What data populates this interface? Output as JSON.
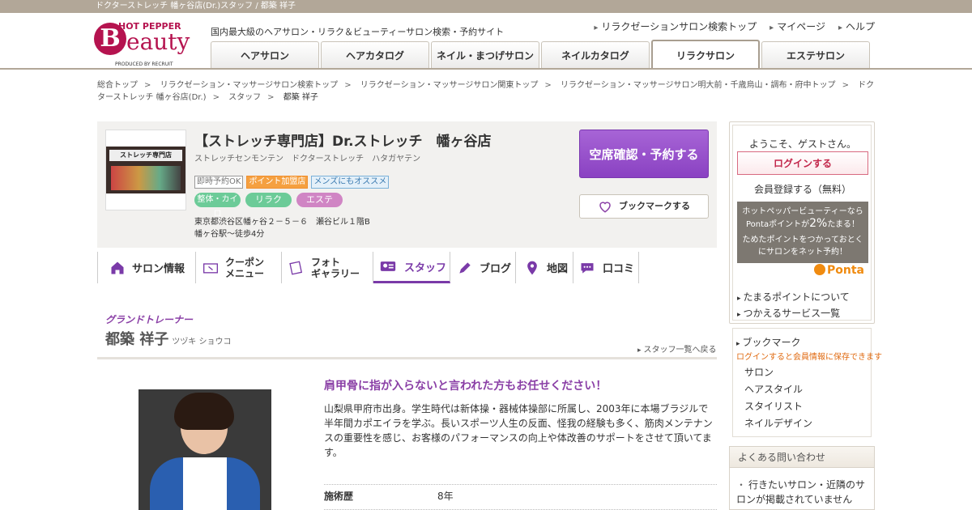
{
  "topbar": {
    "text": "ドクターストレッチ 幡ヶ谷店(Dr.)スタッフ / 都築 祥子"
  },
  "header": {
    "logo_hotpepper": "HOT PEPPER",
    "logo_b": "B",
    "logo_rest": "eauty",
    "logo_produced": "PRODUCED BY RECRUIT",
    "tagline": "国内最大級のヘアサロン・リラク＆ビューティーサロン検索・予約サイト",
    "links": [
      "リラクゼーションサロン検索トップ",
      "マイページ",
      "ヘルプ"
    ],
    "tabs": [
      "ヘアサロン",
      "ヘアカタログ",
      "ネイル・まつげサロン",
      "ネイルカタログ",
      "リラクサロン",
      "エステサロン"
    ],
    "active_tab_index": 4
  },
  "breadcrumbs": [
    "総合トップ",
    "リラクゼーション・マッサージサロン検索トップ",
    "リラクゼーション・マッサージサロン関東トップ",
    "リラクゼーション・マッサージサロン明大前・千歳烏山・調布・府中トップ",
    "ドクターストレッチ 幡ヶ谷店(Dr.)",
    "スタッフ",
    "都築 祥子"
  ],
  "salon": {
    "image_sign": "ストレッチ専門店",
    "title": "【ストレッチ専門店】Dr.ストレッチ　幡ヶ谷店",
    "kana": "ストレッチセンモンテン　ドクターストレッチ　ハタガヤテン",
    "badges": [
      "即時予約OK",
      "ポイント加盟店",
      "メンズにもオススメ"
    ],
    "genres": [
      "整体・カイロ",
      "リラク",
      "エステ"
    ],
    "address": "東京都渋谷区幡ヶ谷２－５－６　瀬谷ビル１階B",
    "access": "幡ヶ谷駅～徒歩4分",
    "reserve_label": "空席確認・予約する",
    "bookmark_label": "ブックマークする"
  },
  "salon_tabs": [
    {
      "label": "サロン情報",
      "icon": "home-icon"
    },
    {
      "label": "クーポン\nメニュー",
      "icon": "coupon-icon"
    },
    {
      "label": "フォト\nギャラリー",
      "icon": "photo-icon"
    },
    {
      "label": "スタッフ",
      "icon": "staff-card-icon",
      "active": true
    },
    {
      "label": "ブログ",
      "icon": "pencil-icon"
    },
    {
      "label": "地図",
      "icon": "map-pin-icon"
    },
    {
      "label": "口コミ",
      "icon": "speech-bubble-icon"
    }
  ],
  "staff": {
    "position": "グランドトレーナー",
    "name": "都築 祥子",
    "kana": "ツヅキ ショウコ",
    "back_link": "スタッフ一覧へ戻る",
    "catch": "肩甲骨に指が入らないと言われた方もお任せください！",
    "description": "山梨県甲府市出身。学生時代は新体操・器械体操部に所属し、2003年に本場ブラジルで半年間カポエイラを学ぶ。長いスポーツ人生の反面、怪我の経験も多く、筋肉メンテナンスの重要性を感じ、お客様のパフォーマンスの向上や体改善のサポートをさせて頂いてます。",
    "experience_label": "施術歴",
    "experience_value": "8年"
  },
  "sidebar": {
    "greeting": "ようこそ、ゲストさん。",
    "login": "ログインする",
    "register": "会員登録する（無料）",
    "ponta_line1": "ホットペッパービューティーなら",
    "ponta_line2_pre": "Pontaポイントが",
    "ponta_pct": "2%",
    "ponta_line2_post": "たまる！",
    "ponta_line3": "ためたポイントをつかっておとく",
    "ponta_line4": "にサロンをネット予約！",
    "ponta_logo": "Ponta",
    "links": [
      "たまるポイントについて",
      "つかえるサービス一覧"
    ],
    "bookmark_title": "ブックマーク",
    "bookmark_note": "ログインすると会員情報に保存できます",
    "bookmark_items": [
      "サロン",
      "ヘアスタイル",
      "スタイリスト",
      "ネイルデザイン"
    ],
    "faq_title": "よくある問い合わせ",
    "faq_first": "行きたいサロン・近隣のサロンが掲載されていません"
  },
  "colors": {
    "brand": "#b5134f",
    "accent_purple": "#8a3fa6",
    "reserve": "#9a52cc",
    "header_bar": "#b2a798"
  }
}
